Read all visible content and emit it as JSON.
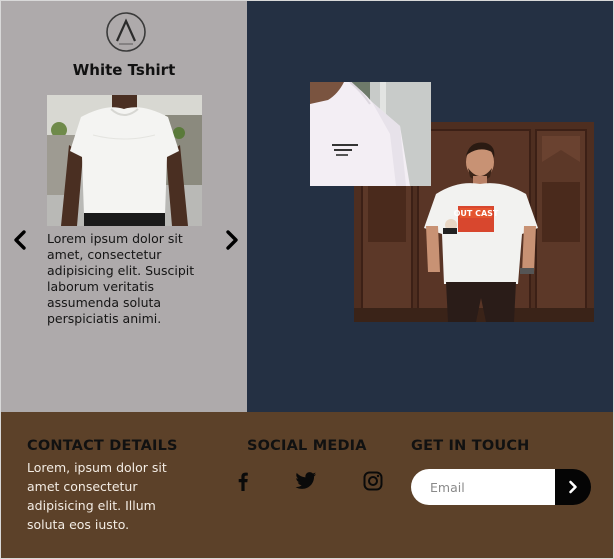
{
  "product": {
    "title": "White Tshirt",
    "description": "Lorem ipsum dolor sit amet, consectetur adipisicing elit. Suscipit laborum veritatis assumenda soluta perspiciatis animi.",
    "logo_icon": "brand-logo-a-icon",
    "prev_icon": "chevron-left-icon",
    "next_icon": "chevron-right-icon"
  },
  "gallery": {
    "main_image": "man-in-graphic-tshirt-photo",
    "detail_image": "tshirt-sleeve-closeup-photo",
    "shirt_print": "OUT CAST"
  },
  "footer": {
    "contact": {
      "heading": "CONTACT DETAILS",
      "text": "Lorem, ipsum dolor sit amet consectetur adipisicing elit. Illum soluta eos iusto."
    },
    "social": {
      "heading": "SOCIAL MEDIA",
      "icons": [
        "facebook-icon",
        "twitter-icon",
        "instagram-icon"
      ]
    },
    "touch": {
      "heading": "GET IN TOUCH",
      "placeholder": "Email",
      "submit_icon": "chevron-right-icon"
    }
  },
  "colors": {
    "left_panel": "#aeaaab",
    "right_panel": "#243043",
    "footer": "#5c4129"
  }
}
